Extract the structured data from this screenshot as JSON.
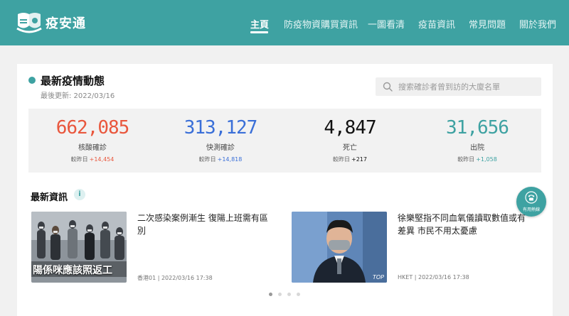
{
  "brand": {
    "name": "疫安通"
  },
  "nav": {
    "items": [
      {
        "label": "主頁",
        "active": true
      },
      {
        "label": "防疫物資購買資訊",
        "active": false
      },
      {
        "label": "一圖看清",
        "active": false
      },
      {
        "label": "疫苗資訊",
        "active": false
      },
      {
        "label": "常見問題",
        "active": false
      },
      {
        "label": "關於我們",
        "active": false
      }
    ]
  },
  "latest": {
    "title": "最新疫情動態",
    "updated": "最後更新: 2022/03/16"
  },
  "search": {
    "placeholder": "搜索確診者曾到訪的大廈名單"
  },
  "stats": [
    {
      "value": "662,085",
      "label": "核酸確診",
      "diff_prefix": "較昨日",
      "diff": "+14,454",
      "color": "#e9573d"
    },
    {
      "value": "313,127",
      "label": "快測確診",
      "diff_prefix": "較昨日",
      "diff": "+14,818",
      "color": "#3a6fd8"
    },
    {
      "value": "4,847",
      "label": "死亡",
      "diff_prefix": "較昨日",
      "diff": "+217",
      "color": "#111111"
    },
    {
      "value": "31,656",
      "label": "出院",
      "diff_prefix": "較昨日",
      "diff": "+1,058",
      "color": "#3ea2a2"
    }
  ],
  "news_section": {
    "title": "最新資訊",
    "info": "i"
  },
  "news": [
    {
      "headline": "二次感染案例漸生 復陽上班需有區別",
      "source": "香港01",
      "time": "2022/03/16 17:38",
      "caption": "陽係咪應該照返工"
    },
    {
      "headline": "徐樂堅指不同血氧儀讀取數值或有差異 市民不用太憂慮",
      "source": "HKET",
      "time": "2022/03/16 17:38",
      "caption": "TOP"
    }
  ],
  "hotline": {
    "label": "有用熱線"
  },
  "colors": {
    "accent": "#3ea2a2"
  }
}
